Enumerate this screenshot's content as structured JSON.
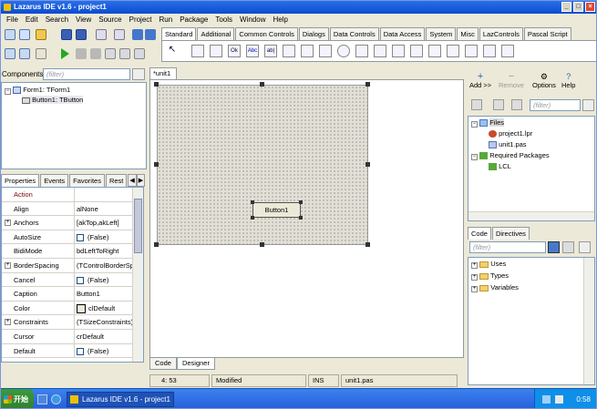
{
  "window": {
    "title": "Lazarus IDE v1.6 - project1"
  },
  "menu": [
    "File",
    "Edit",
    "Search",
    "View",
    "Source",
    "Project",
    "Run",
    "Package",
    "Tools",
    "Window",
    "Help"
  ],
  "palette": {
    "tabs": [
      "Standard",
      "Additional",
      "Common Controls",
      "Dialogs",
      "Data Controls",
      "Data Access",
      "System",
      "Misc",
      "LazControls",
      "Pascal Script"
    ],
    "icon_labels": [
      "Ok",
      "Abc",
      "ab|"
    ]
  },
  "components": {
    "label": "Components",
    "filter_placeholder": "(filter)",
    "tree": [
      "Form1: TForm1",
      "Button1: TButton"
    ]
  },
  "inspector": {
    "tabs": [
      "Properties",
      "Events",
      "Favorites",
      "Rest"
    ],
    "properties": [
      {
        "name": "Action",
        "value": ""
      },
      {
        "name": "Align",
        "value": "alNone"
      },
      {
        "name": "Anchors",
        "value": "[akTop,akLeft]"
      },
      {
        "name": "AutoSize",
        "value": "(False)"
      },
      {
        "name": "BidiMode",
        "value": "bdLeftToRight"
      },
      {
        "name": "BorderSpacing",
        "value": "(TControlBorderSp"
      },
      {
        "name": "Cancel",
        "value": "(False)"
      },
      {
        "name": "Caption",
        "value": "Button1"
      },
      {
        "name": "Color",
        "value": "clDefault"
      },
      {
        "name": "Constraints",
        "value": "(TSizeConstraints)"
      },
      {
        "name": "Cursor",
        "value": "crDefault"
      },
      {
        "name": "Default",
        "value": "(False)"
      }
    ]
  },
  "editor": {
    "tab": "*unit1",
    "button_caption": "Button1",
    "bottom_tabs": [
      "Code",
      "Designer"
    ]
  },
  "status": {
    "position": "4: 53",
    "state": "Modified",
    "mode": "INS",
    "file": "unit1.pas"
  },
  "project": {
    "tools": [
      "Add >>",
      "Remove",
      "Options",
      "Help"
    ],
    "filter_placeholder": "(filter)",
    "tree": [
      "Files",
      "project1.lpr",
      "unit1.pas",
      "Required Packages",
      "LCL"
    ]
  },
  "code_explorer": {
    "tabs": [
      "Code",
      "Directives"
    ],
    "filter_placeholder": "(filter)",
    "tree": [
      "Uses",
      "Types",
      "Variables"
    ]
  },
  "taskbar": {
    "start": "开始",
    "task": "Lazarus IDE v1.6 - project1",
    "clock": "0:58"
  }
}
